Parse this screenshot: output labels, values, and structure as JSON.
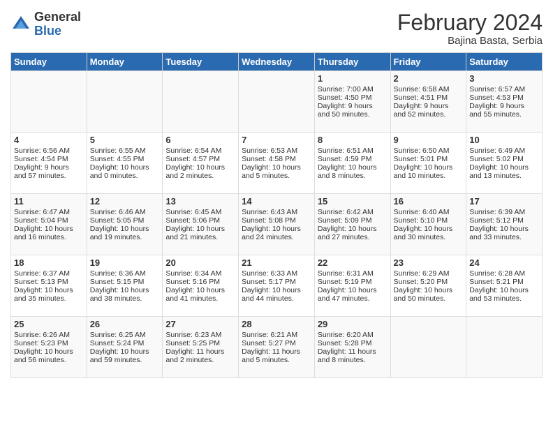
{
  "header": {
    "logo_general": "General",
    "logo_blue": "Blue",
    "month_title": "February 2024",
    "location": "Bajina Basta, Serbia"
  },
  "days_of_week": [
    "Sunday",
    "Monday",
    "Tuesday",
    "Wednesday",
    "Thursday",
    "Friday",
    "Saturday"
  ],
  "weeks": [
    [
      {
        "day": "",
        "content": ""
      },
      {
        "day": "",
        "content": ""
      },
      {
        "day": "",
        "content": ""
      },
      {
        "day": "",
        "content": ""
      },
      {
        "day": "1",
        "content": "Sunrise: 7:00 AM\nSunset: 4:50 PM\nDaylight: 9 hours\nand 50 minutes."
      },
      {
        "day": "2",
        "content": "Sunrise: 6:58 AM\nSunset: 4:51 PM\nDaylight: 9 hours\nand 52 minutes."
      },
      {
        "day": "3",
        "content": "Sunrise: 6:57 AM\nSunset: 4:53 PM\nDaylight: 9 hours\nand 55 minutes."
      }
    ],
    [
      {
        "day": "4",
        "content": "Sunrise: 6:56 AM\nSunset: 4:54 PM\nDaylight: 9 hours\nand 57 minutes."
      },
      {
        "day": "5",
        "content": "Sunrise: 6:55 AM\nSunset: 4:55 PM\nDaylight: 10 hours\nand 0 minutes."
      },
      {
        "day": "6",
        "content": "Sunrise: 6:54 AM\nSunset: 4:57 PM\nDaylight: 10 hours\nand 2 minutes."
      },
      {
        "day": "7",
        "content": "Sunrise: 6:53 AM\nSunset: 4:58 PM\nDaylight: 10 hours\nand 5 minutes."
      },
      {
        "day": "8",
        "content": "Sunrise: 6:51 AM\nSunset: 4:59 PM\nDaylight: 10 hours\nand 8 minutes."
      },
      {
        "day": "9",
        "content": "Sunrise: 6:50 AM\nSunset: 5:01 PM\nDaylight: 10 hours\nand 10 minutes."
      },
      {
        "day": "10",
        "content": "Sunrise: 6:49 AM\nSunset: 5:02 PM\nDaylight: 10 hours\nand 13 minutes."
      }
    ],
    [
      {
        "day": "11",
        "content": "Sunrise: 6:47 AM\nSunset: 5:04 PM\nDaylight: 10 hours\nand 16 minutes."
      },
      {
        "day": "12",
        "content": "Sunrise: 6:46 AM\nSunset: 5:05 PM\nDaylight: 10 hours\nand 19 minutes."
      },
      {
        "day": "13",
        "content": "Sunrise: 6:45 AM\nSunset: 5:06 PM\nDaylight: 10 hours\nand 21 minutes."
      },
      {
        "day": "14",
        "content": "Sunrise: 6:43 AM\nSunset: 5:08 PM\nDaylight: 10 hours\nand 24 minutes."
      },
      {
        "day": "15",
        "content": "Sunrise: 6:42 AM\nSunset: 5:09 PM\nDaylight: 10 hours\nand 27 minutes."
      },
      {
        "day": "16",
        "content": "Sunrise: 6:40 AM\nSunset: 5:10 PM\nDaylight: 10 hours\nand 30 minutes."
      },
      {
        "day": "17",
        "content": "Sunrise: 6:39 AM\nSunset: 5:12 PM\nDaylight: 10 hours\nand 33 minutes."
      }
    ],
    [
      {
        "day": "18",
        "content": "Sunrise: 6:37 AM\nSunset: 5:13 PM\nDaylight: 10 hours\nand 35 minutes."
      },
      {
        "day": "19",
        "content": "Sunrise: 6:36 AM\nSunset: 5:15 PM\nDaylight: 10 hours\nand 38 minutes."
      },
      {
        "day": "20",
        "content": "Sunrise: 6:34 AM\nSunset: 5:16 PM\nDaylight: 10 hours\nand 41 minutes."
      },
      {
        "day": "21",
        "content": "Sunrise: 6:33 AM\nSunset: 5:17 PM\nDaylight: 10 hours\nand 44 minutes."
      },
      {
        "day": "22",
        "content": "Sunrise: 6:31 AM\nSunset: 5:19 PM\nDaylight: 10 hours\nand 47 minutes."
      },
      {
        "day": "23",
        "content": "Sunrise: 6:29 AM\nSunset: 5:20 PM\nDaylight: 10 hours\nand 50 minutes."
      },
      {
        "day": "24",
        "content": "Sunrise: 6:28 AM\nSunset: 5:21 PM\nDaylight: 10 hours\nand 53 minutes."
      }
    ],
    [
      {
        "day": "25",
        "content": "Sunrise: 6:26 AM\nSunset: 5:23 PM\nDaylight: 10 hours\nand 56 minutes."
      },
      {
        "day": "26",
        "content": "Sunrise: 6:25 AM\nSunset: 5:24 PM\nDaylight: 10 hours\nand 59 minutes."
      },
      {
        "day": "27",
        "content": "Sunrise: 6:23 AM\nSunset: 5:25 PM\nDaylight: 11 hours\nand 2 minutes."
      },
      {
        "day": "28",
        "content": "Sunrise: 6:21 AM\nSunset: 5:27 PM\nDaylight: 11 hours\nand 5 minutes."
      },
      {
        "day": "29",
        "content": "Sunrise: 6:20 AM\nSunset: 5:28 PM\nDaylight: 11 hours\nand 8 minutes."
      },
      {
        "day": "",
        "content": ""
      },
      {
        "day": "",
        "content": ""
      }
    ]
  ]
}
